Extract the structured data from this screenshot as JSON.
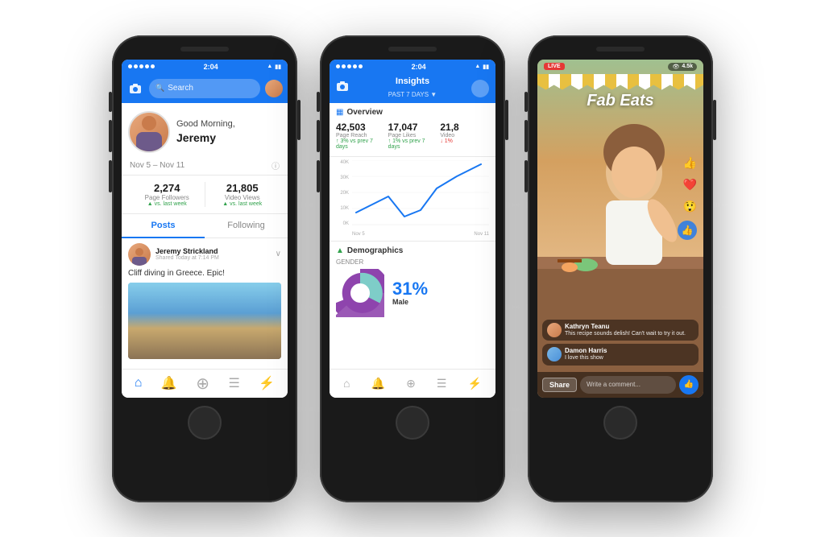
{
  "scene": {
    "background": "#ffffff"
  },
  "phone1": {
    "status": {
      "dots": 5,
      "time": "2:04",
      "signal": "●●●●",
      "wifi": "WiFi",
      "battery": "■■"
    },
    "header": {
      "search_placeholder": "Search"
    },
    "profile": {
      "greeting_top": "Good Morning,",
      "greeting_name": "Jeremy"
    },
    "date_range": "Nov 5 – Nov 11",
    "stats": {
      "followers_num": "2,274",
      "followers_label": "Page Followers",
      "followers_change": "vs. last week",
      "views_num": "21,805",
      "views_label": "Video Views",
      "views_change": "vs. last week"
    },
    "tabs": {
      "posts": "Posts",
      "following": "Following"
    },
    "post": {
      "author": "Jeremy Strickland",
      "meta": "Shared Today at 7:14 PM",
      "text": "Cliff diving in Greece. Epic!"
    },
    "nav": {
      "home": "🏠",
      "bell": "🔔",
      "plus": "⊕",
      "menu": "☰",
      "graph": "📊"
    }
  },
  "phone2": {
    "status": {
      "time": "2:04"
    },
    "header": {
      "title": "Insights",
      "subtitle": "PAST 7 DAYS ▼"
    },
    "overview": {
      "section_label": "Overview",
      "metric1_num": "42,503",
      "metric1_label": "Page Reach",
      "metric1_change": "↑ 3% vs prev 7 days",
      "metric2_num": "17,047",
      "metric2_label": "Page Likes",
      "metric2_change": "↑ 1% vs prev 7 days",
      "metric3_num": "21,8",
      "metric3_label": "Video",
      "metric3_change": "↓ 1%"
    },
    "chart": {
      "y_labels": [
        "40K",
        "30K",
        "20K",
        "10K",
        "0K"
      ],
      "x_labels": [
        "Nov 5",
        "Nov 11"
      ],
      "line_points": "10,80 30,65 50,50 70,75 90,70 110,40 130,20 150,5"
    },
    "demographics": {
      "section_label": "Demographics",
      "gender_label": "GENDER",
      "male_pct": "31%",
      "male_label": "Male",
      "female_pct": "69%"
    },
    "nav": {
      "home": "🏠",
      "bell": "🔔",
      "plus": "⊕",
      "menu": "☰",
      "graph": "📊"
    }
  },
  "phone3": {
    "status": {
      "time": ""
    },
    "live_badge": "LIVE",
    "view_count": "4.5k",
    "channel_name": "Fab Eats",
    "reactions": [
      "👍",
      "❤️",
      "😲"
    ],
    "comments": [
      {
        "name": "Kathryn Teanu",
        "text": "This recipe sounds delish! Can't wait to try it out."
      },
      {
        "name": "Damon Harris",
        "text": "I love this show"
      }
    ],
    "share_label": "Share",
    "comment_placeholder": "Write a comment..."
  }
}
